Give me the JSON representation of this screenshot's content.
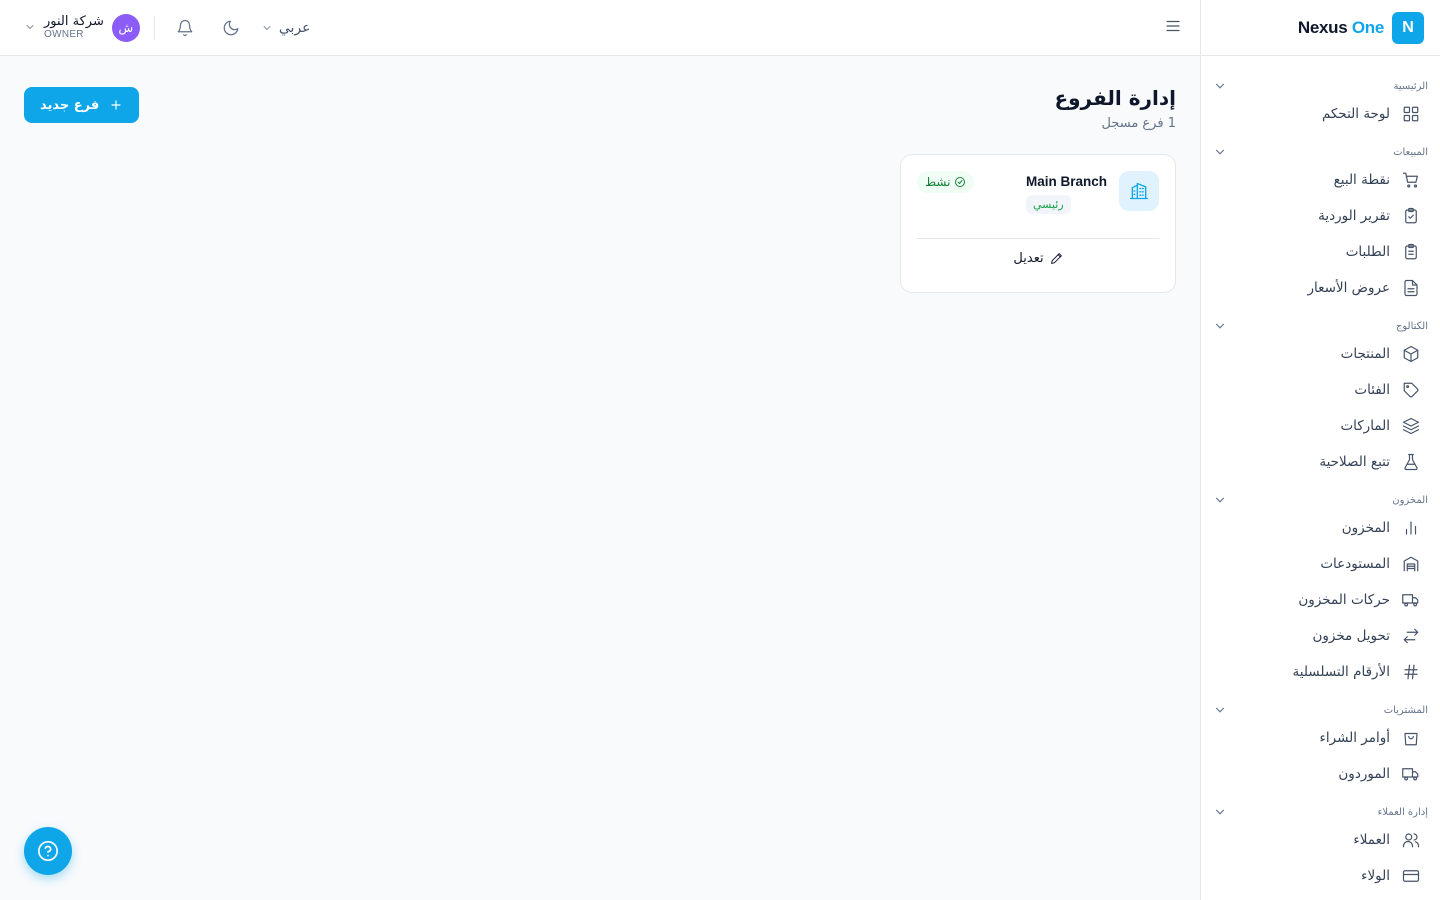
{
  "brand": {
    "logo_letter": "N",
    "name_part1": "Nexus",
    "name_part2": "One"
  },
  "sidebar": {
    "sections": [
      {
        "title": "الرئيسية",
        "items": [
          {
            "label": "لوحة التحكم",
            "icon": "dashboard-icon"
          }
        ]
      },
      {
        "title": "المبيعات",
        "items": [
          {
            "label": "نقطة البيع",
            "icon": "cart-icon"
          },
          {
            "label": "تقرير الوردية",
            "icon": "clipboard-check-icon"
          },
          {
            "label": "الطلبات",
            "icon": "clipboard-list-icon"
          },
          {
            "label": "عروض الأسعار",
            "icon": "file-text-icon"
          }
        ]
      },
      {
        "title": "الكتالوج",
        "items": [
          {
            "label": "المنتجات",
            "icon": "package-icon"
          },
          {
            "label": "الفئات",
            "icon": "tag-icon"
          },
          {
            "label": "الماركات",
            "icon": "layers-icon"
          },
          {
            "label": "تتبع الصلاحية",
            "icon": "flask-icon"
          }
        ]
      },
      {
        "title": "المخزون",
        "items": [
          {
            "label": "المخزون",
            "icon": "bar-chart-icon"
          },
          {
            "label": "المستودعات",
            "icon": "warehouse-icon"
          },
          {
            "label": "حركات المخزون",
            "icon": "truck-icon"
          },
          {
            "label": "تحويل مخزون",
            "icon": "transfer-icon"
          },
          {
            "label": "الأرقام التسلسلية",
            "icon": "hash-icon"
          }
        ]
      },
      {
        "title": "المشتريات",
        "items": [
          {
            "label": "أوامر الشراء",
            "icon": "shopping-bag-icon"
          },
          {
            "label": "الموردون",
            "icon": "truck-icon"
          }
        ]
      },
      {
        "title": "إدارة العملاء",
        "items": [
          {
            "label": "العملاء",
            "icon": "users-icon"
          },
          {
            "label": "الولاء",
            "icon": "credit-card-icon"
          }
        ]
      }
    ]
  },
  "header": {
    "language": "عربي",
    "user": {
      "avatar_letter": "ش",
      "name": "شركة النور",
      "role": "OWNER"
    }
  },
  "page": {
    "title": "إدارة الفروع",
    "subtitle": "1 فرع مسجل",
    "new_button": "فرع جديد"
  },
  "branch": {
    "name": "Main Branch",
    "type_badge": "رئيسي",
    "status": "نشط",
    "edit_label": "تعديل"
  },
  "colors": {
    "accent": "#0ea5e9",
    "avatar": "#8b5cf6",
    "active_green": "#15803d"
  }
}
